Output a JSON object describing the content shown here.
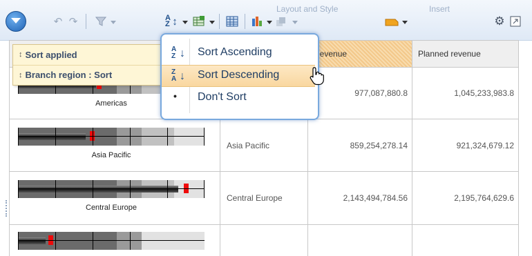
{
  "toolbar": {
    "ghost_labels": [
      "Layout and Style",
      "Insert"
    ],
    "icons": [
      "app-menu-icon",
      "save-icon",
      "undo-icon",
      "redo-icon",
      "filter-icon",
      "sort-icon",
      "summary-icon",
      "grid-icon",
      "chart-icon",
      "drill-icon",
      "style-icon",
      "settings-icon",
      "expand-icon"
    ]
  },
  "grid": {
    "columns": [
      "Revenue",
      "Planned revenue"
    ],
    "rows": [
      {
        "region": "Americas",
        "show_region_cell": false,
        "revenue": "977,087,880.8",
        "planned": "1,045,233,983.8",
        "bar": 0.42,
        "marker": 0.43
      },
      {
        "region": "Asia Pacific",
        "show_region_cell": true,
        "revenue": "859,254,278.14",
        "planned": "921,324,679.12",
        "bar": 0.36,
        "marker": 0.39
      },
      {
        "region": "Central Europe",
        "show_region_cell": true,
        "revenue": "2,143,494,784.56",
        "planned": "2,195,764,629.6",
        "bar": 0.86,
        "marker": 0.89
      }
    ]
  },
  "tooltip": {
    "line1": "Sort applied",
    "line2": "Branch region : Sort",
    "icon1": "sort-applied-icon",
    "icon2": "sort-order-icon"
  },
  "menu": {
    "items": [
      {
        "label": "Sort Ascending",
        "icon": "A↓Z",
        "icon_name": "sort-ascending-icon"
      },
      {
        "label": "Sort Descending",
        "icon": "Z↓A",
        "icon_name": "sort-descending-icon",
        "highlighted": true
      },
      {
        "label": "Don't Sort",
        "icon": "•",
        "icon_name": "bullet-icon"
      }
    ]
  },
  "colors": {
    "accent": "#79a9de",
    "highlight": "#f9d7a0",
    "revenue_header": "#f3c88a",
    "marker": "#ee0a0a"
  }
}
